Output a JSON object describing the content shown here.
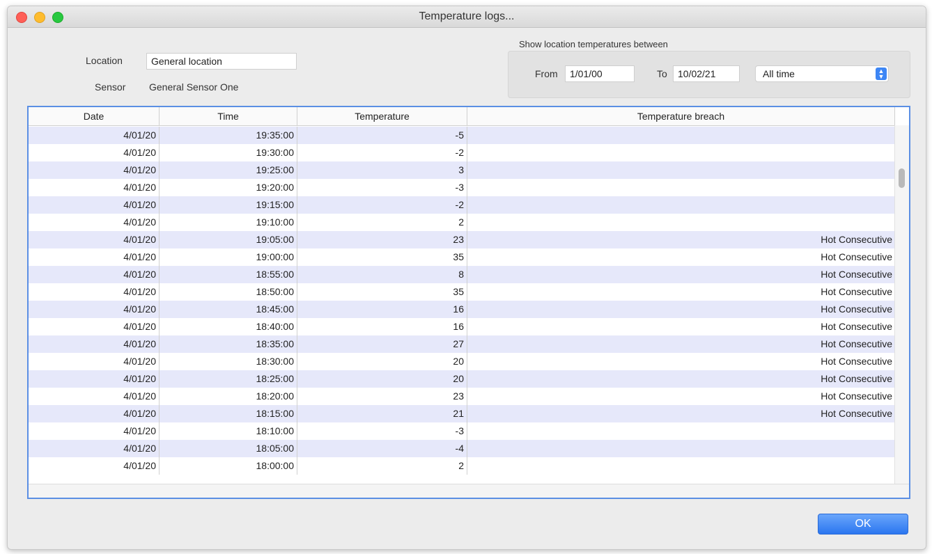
{
  "window": {
    "title": "Temperature logs..."
  },
  "form": {
    "location_label": "Location",
    "location_value": "General location",
    "sensor_label": "Sensor",
    "sensor_value": "General Sensor One"
  },
  "range": {
    "group_title": "Show location temperatures between",
    "from_label": "From",
    "from_value": "1/01/00",
    "to_label": "To",
    "to_value": "10/02/21",
    "preset": "All time"
  },
  "table": {
    "columns": [
      "Date",
      "Time",
      "Temperature",
      "Temperature breach"
    ],
    "rows": [
      [
        "4/01/20",
        "19:35:00",
        "-5",
        ""
      ],
      [
        "4/01/20",
        "19:30:00",
        "-2",
        ""
      ],
      [
        "4/01/20",
        "19:25:00",
        "3",
        ""
      ],
      [
        "4/01/20",
        "19:20:00",
        "-3",
        ""
      ],
      [
        "4/01/20",
        "19:15:00",
        "-2",
        ""
      ],
      [
        "4/01/20",
        "19:10:00",
        "2",
        ""
      ],
      [
        "4/01/20",
        "19:05:00",
        "23",
        "Hot Consecutive"
      ],
      [
        "4/01/20",
        "19:00:00",
        "35",
        "Hot Consecutive"
      ],
      [
        "4/01/20",
        "18:55:00",
        "8",
        "Hot Consecutive"
      ],
      [
        "4/01/20",
        "18:50:00",
        "35",
        "Hot Consecutive"
      ],
      [
        "4/01/20",
        "18:45:00",
        "16",
        "Hot Consecutive"
      ],
      [
        "4/01/20",
        "18:40:00",
        "16",
        "Hot Consecutive"
      ],
      [
        "4/01/20",
        "18:35:00",
        "27",
        "Hot Consecutive"
      ],
      [
        "4/01/20",
        "18:30:00",
        "20",
        "Hot Consecutive"
      ],
      [
        "4/01/20",
        "18:25:00",
        "20",
        "Hot Consecutive"
      ],
      [
        "4/01/20",
        "18:20:00",
        "23",
        "Hot Consecutive"
      ],
      [
        "4/01/20",
        "18:15:00",
        "21",
        "Hot Consecutive"
      ],
      [
        "4/01/20",
        "18:10:00",
        "-3",
        ""
      ],
      [
        "4/01/20",
        "18:05:00",
        "-4",
        ""
      ],
      [
        "4/01/20",
        "18:00:00",
        "2",
        ""
      ]
    ]
  },
  "buttons": {
    "ok_label": "OK"
  },
  "colors": {
    "accent": "#2a76f0",
    "row_alt": "#e6e8fa",
    "focus_border": "#5b8fe4"
  },
  "icons": {
    "preset_dropdown": "up-down-chevron-icon"
  }
}
